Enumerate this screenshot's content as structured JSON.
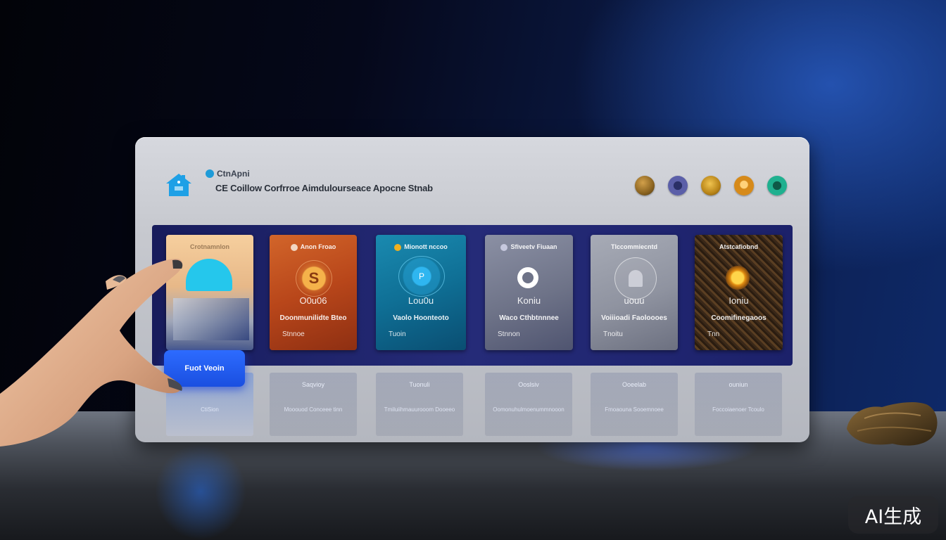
{
  "header": {
    "brand_name": "CtnApni",
    "title": "CE Coillow Corfrroe Aimdulourseace Apocne Stnab"
  },
  "header_icons": [
    {
      "name": "bronze-coin-icon",
      "color": "#8a6320"
    },
    {
      "name": "purple-disc-icon",
      "color": "#5b5fa8"
    },
    {
      "name": "gold-coin-icon",
      "color": "#b88418"
    },
    {
      "name": "orange-coin-icon",
      "color": "#d68a1a"
    },
    {
      "name": "teal-disc-icon",
      "color": "#1fb08f"
    }
  ],
  "cards": [
    {
      "header": "Crotnamnlon",
      "code": "",
      "line1": "",
      "line2": "",
      "accent": "#f2c38f",
      "glyph": "cyan-dome-icon",
      "lower_label": "",
      "lower_sub": "CtiSion"
    },
    {
      "header": "Anon Froao",
      "code": "O0u06",
      "line1": "Doonmunilidte Bteo",
      "line2": "Stnnoe",
      "accent": "#c8521e",
      "glyph": "orange-s-coin-icon",
      "lower_label": "Saqvioy",
      "lower_sub": "Mooouod Conceee tinn"
    },
    {
      "header": "Mionott nccoo",
      "code": "Lou0u",
      "line1": "Vaolo Hoonteoto",
      "line2": "Tuoin",
      "accent": "#0f6f95",
      "glyph": "cyan-target-icon",
      "lower_label": "Tuonuli",
      "lower_sub": "Tmiluiihmauurooom Dooeeo"
    },
    {
      "header": "Sfiveetv Fiuaan",
      "code": "Koniu",
      "line1": "Waco Cthbtnnnee",
      "line2": "Stnnon",
      "accent": "#7a7f94",
      "glyph": "white-ring-icon",
      "lower_label": "Ooslsiv",
      "lower_sub": "Oomonuhulmoenummnooon"
    },
    {
      "header": "Tlccommiecntd",
      "code": "uouu",
      "line1": "Voiiioadi Faoloooes",
      "line2": "Tnoitu",
      "accent": "#8f93a0",
      "glyph": "grey-bell-icon",
      "lower_label": "Ooeelab",
      "lower_sub": "Fmoaouna Sooemnoee"
    },
    {
      "header": "Atstcafiobnd",
      "code": "Ioniu",
      "line1": "Coomifinegaoos",
      "line2": "Tnn",
      "accent": "#3a2818",
      "glyph": "gold-ornament-icon",
      "lower_label": "ouniun",
      "lower_sub": "Foccoiaenoer Tcoulo"
    }
  ],
  "start_button": {
    "label": "Fuot Veoin"
  },
  "watermark": "AI生成"
}
